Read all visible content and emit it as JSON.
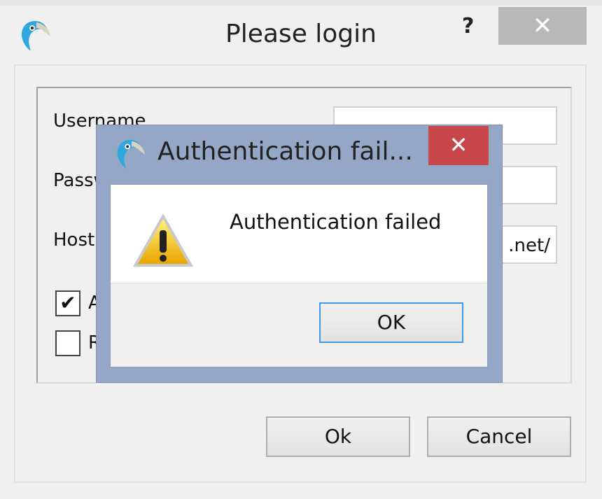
{
  "window": {
    "title": "Please login",
    "help_label": "?",
    "close_label": "✕",
    "app_icon": "parrot-logo-icon"
  },
  "form": {
    "username_label": "Username",
    "username_value": "",
    "password_label": "Password",
    "password_value": "",
    "host_label": "Host",
    "host_value_visible": ".net/",
    "checkbox1": {
      "label_visible": "A",
      "checked": true,
      "mark": "✔"
    },
    "checkbox2": {
      "label_visible": "R",
      "checked": false
    }
  },
  "buttons": {
    "ok": "Ok",
    "cancel": "Cancel"
  },
  "alert": {
    "title": "Authentication fail...",
    "close_label": "✕",
    "message": "Authentication failed",
    "ok": "OK",
    "icon": "warning-icon"
  },
  "colors": {
    "alert_frame": "#94a7c6",
    "alert_close": "#c7474a",
    "focus": "#3c9bf0"
  }
}
